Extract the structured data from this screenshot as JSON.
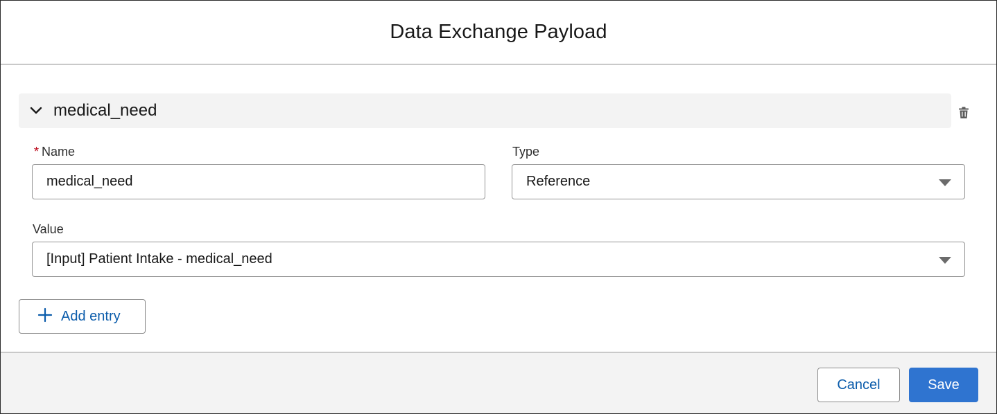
{
  "modal": {
    "title": "Data Exchange Payload"
  },
  "section": {
    "title": "medical_need",
    "expanded": true,
    "chevron_icon": "chevron-down-icon",
    "delete_icon": "trash-icon"
  },
  "fields": {
    "name": {
      "label": "Name",
      "required_marker": "*",
      "value": "medical_need"
    },
    "type": {
      "label": "Type",
      "selected": "Reference"
    },
    "value": {
      "label": "Value",
      "selected": "[Input] Patient Intake - medical_need"
    }
  },
  "actions": {
    "add_entry_label": "Add entry",
    "add_icon": "plus-icon"
  },
  "footer": {
    "cancel_label": "Cancel",
    "save_label": "Save"
  },
  "colors": {
    "brand": "#2f74d0",
    "link": "#0b5cab",
    "required": "#ba0517",
    "section_bg": "#f3f3f3"
  }
}
